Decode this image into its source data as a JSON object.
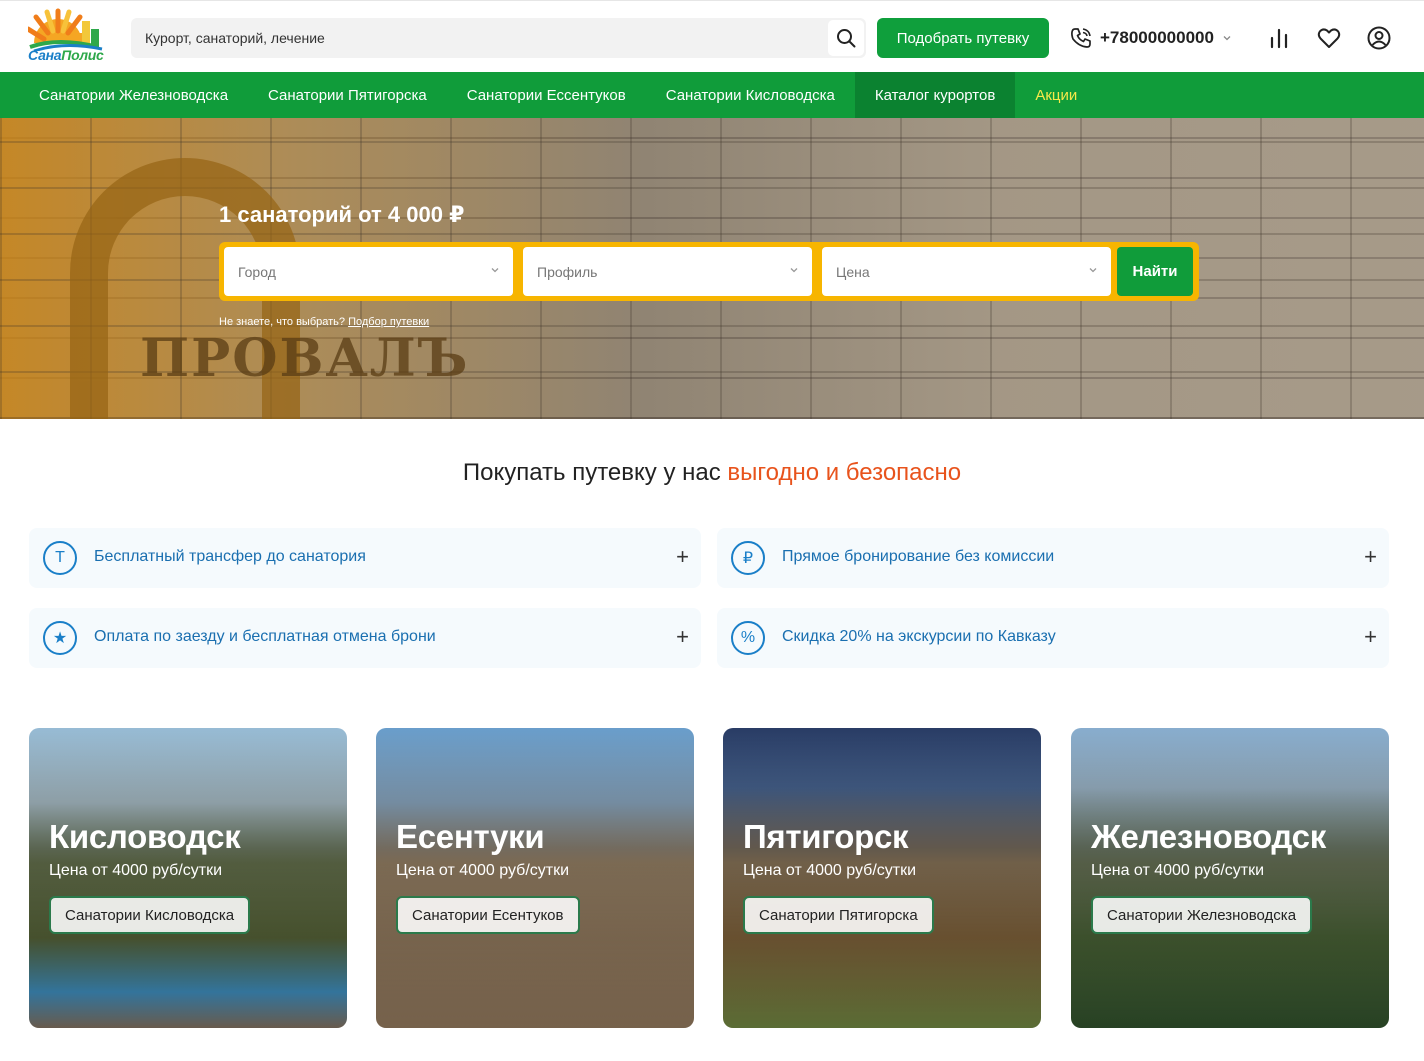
{
  "header": {
    "logo": {
      "part1": "Сана",
      "part2": "Полис"
    },
    "search_placeholder": "Курорт, санаторий, лечение",
    "pick_button": "Подобрать путевку",
    "phone": "+78000000000"
  },
  "nav": {
    "items": [
      {
        "label": "Санатории Железноводска"
      },
      {
        "label": "Санатории Пятигорска"
      },
      {
        "label": "Санатории Ессентуков"
      },
      {
        "label": "Санатории Кисловодска"
      },
      {
        "label": "Каталог курортов"
      },
      {
        "label": "Акции"
      }
    ]
  },
  "hero": {
    "sign": "ПРОВАЛЪ",
    "title": "1 санаторий от 4 000 ₽",
    "city": "Город",
    "profile": "Профиль",
    "price": "Цена",
    "find_button": "Найти",
    "hint": "Не знаете, что выбрать?",
    "hint_link": "Подбор путевки"
  },
  "benefits": {
    "title_main": "Покупать путевку у нас ",
    "title_accent": "выгодно и безопасно",
    "items": [
      {
        "glyph": "Т",
        "label": "Бесплатный трансфер до санатория"
      },
      {
        "glyph": "₽",
        "label": "Прямое бронирование без комиссии"
      },
      {
        "glyph": "★",
        "label": "Оплата по заезду и бесплатная отмена брони"
      },
      {
        "glyph": "%",
        "label": "Скидка 20% на экскурсии по Кавказу"
      }
    ],
    "plus": "+"
  },
  "cards": [
    {
      "title": "Кисловодск",
      "price": "Цена от 4000 руб/сутки",
      "button": "Санатории Кисловодска"
    },
    {
      "title": "Есентуки",
      "price": "Цена от 4000 руб/сутки",
      "button": "Санатории Есентуков"
    },
    {
      "title": "Пятигорск",
      "price": "Цена от 4000 руб/сутки",
      "button": "Санатории Пятигорска"
    },
    {
      "title": "Железноводск",
      "price": "Цена от 4000 руб/сутки",
      "button": "Санатории Железноводска"
    }
  ],
  "colors": {
    "brand_green": "#109c3a",
    "nav_active": "#0b8230",
    "promo_yellow": "#f7e94a",
    "hero_form": "#f7b500",
    "accent_orange": "#e8531c",
    "link_blue": "#1a7fc8"
  }
}
